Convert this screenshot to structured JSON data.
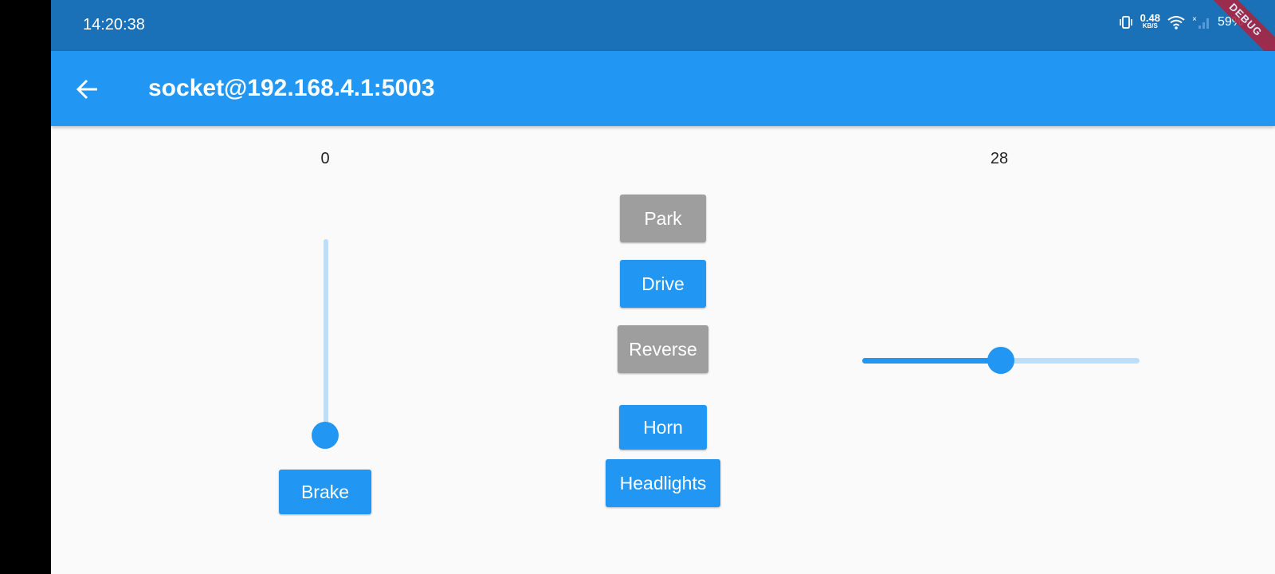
{
  "status_bar": {
    "time": "14:20:38",
    "net_speed": "0.48",
    "net_unit": "KB/S",
    "battery": "59%",
    "debug_label": "DEBUG",
    "icons": [
      "vibrate-icon",
      "wifi-icon",
      "signal-icon",
      "battery-icon"
    ]
  },
  "app_bar": {
    "title": "socket@192.168.4.1:5003",
    "back_icon": "arrow-left-icon"
  },
  "left_slider": {
    "value_label": "0",
    "fraction": 0.0
  },
  "right_slider": {
    "value_label": "28",
    "fraction": 0.5
  },
  "buttons": {
    "park": "Park",
    "drive": "Drive",
    "reverse": "Reverse",
    "horn": "Horn",
    "headlights": "Headlights",
    "brake": "Brake"
  },
  "colors": {
    "primary": "#2196f3",
    "inactive": "#9e9e9e",
    "status_bar": "#1a71b8"
  }
}
